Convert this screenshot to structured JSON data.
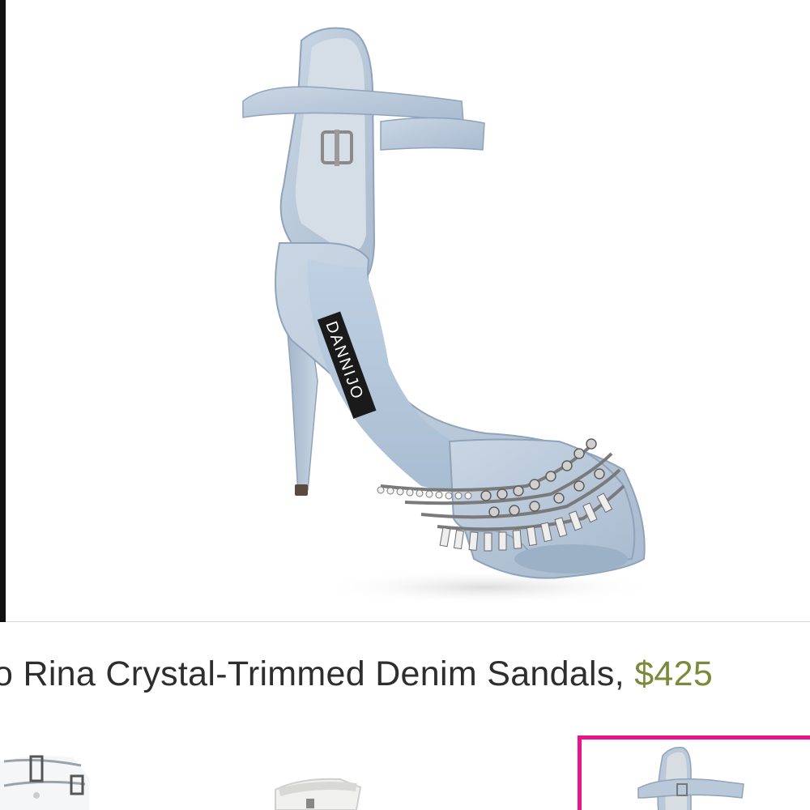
{
  "product": {
    "brand_label": "DANNIJO",
    "title": "o Rina Crystal-Trimmed Denim Sandals, ",
    "price": "$425"
  },
  "colors": {
    "price": "#7a8a3a",
    "selected_thumb_border": "#e8158a",
    "denim": "#b9c9da"
  },
  "thumbnails": [
    {
      "name": "thumbnail-clear-sandal"
    },
    {
      "name": "thumbnail-white-sandal"
    },
    {
      "name": "thumbnail-denim-sandal",
      "selected": true
    }
  ]
}
